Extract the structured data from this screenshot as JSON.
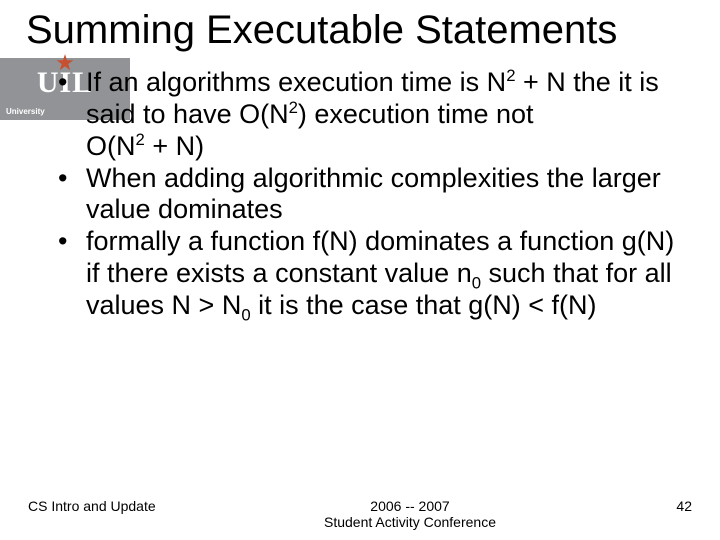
{
  "logo": {
    "uil": "UIL",
    "sub": "University"
  },
  "title": "Summing Executable Statements",
  "bullets": {
    "b1": {
      "p1": "If an algorithms execution time is N",
      "sup1": "2",
      "p2": " + N the it is said to have O(N",
      "sup2": "2",
      "p3": ") execution time not",
      "p4": "O(N",
      "sup3": "2",
      "p5": " + N)"
    },
    "b2": "When adding algorithmic complexities the larger value dominates",
    "b3": {
      "p1": "formally a function f(N) dominates a function g(N) if there exists a constant value n",
      "sub1": "0",
      "p2": " such that for all values N > N",
      "sub2": "0",
      "p3": "  it is the case that g(N) < f(N)"
    }
  },
  "footer": {
    "left": "CS Intro and Update",
    "center1": "2006 -- 2007",
    "center2": "Student Activity Conference",
    "right": "42"
  }
}
